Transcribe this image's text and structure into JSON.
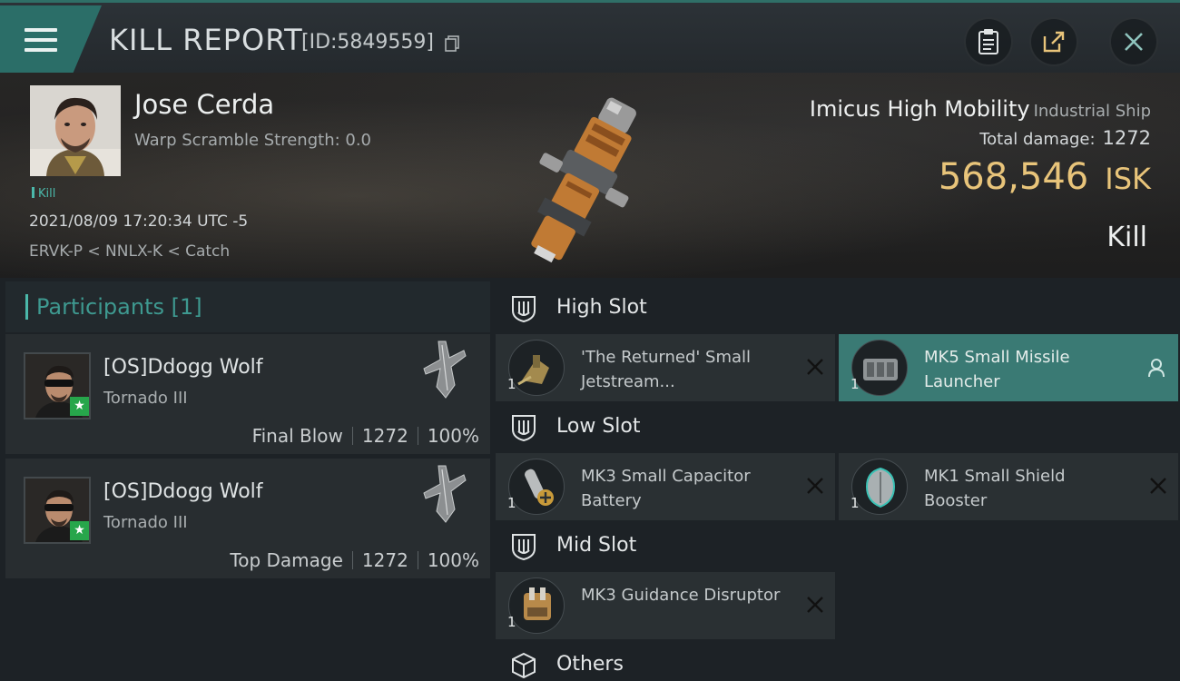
{
  "header": {
    "title": "KILL REPORT",
    "report_id": "[ID:5849559]",
    "icons": [
      "menu-icon",
      "copy-icon",
      "clipboard-icon",
      "share-icon",
      "close-icon"
    ]
  },
  "victim": {
    "name": "Jose Cerda",
    "warp_scramble": "Warp Scramble Strength: 0.0",
    "tag": "Kill",
    "datetime": "2021/08/09 17:20:34 UTC -5",
    "route": "ERVK-P < NNLX-K < Catch",
    "ship_name": "Imicus High Mobility",
    "ship_class": "Industrial Ship",
    "total_damage_label": "Total damage:",
    "total_damage": "1272",
    "isk_value": "568,546",
    "isk_unit": "ISK",
    "result": "Kill"
  },
  "participants": {
    "header": "Participants [1]",
    "items": [
      {
        "name": "[OS]Ddogg Wolf",
        "ship": "Tornado III",
        "role": "Final Blow",
        "damage": "1272",
        "percent": "100%"
      },
      {
        "name": "[OS]Ddogg Wolf",
        "ship": "Tornado III",
        "role": "Top Damage",
        "damage": "1272",
        "percent": "100%"
      }
    ]
  },
  "slots": {
    "high": {
      "label": "High Slot",
      "items": [
        {
          "name": "'The Returned' Small Jetstream...",
          "qty": "1"
        },
        {
          "name": "MK5 Small Missile Launcher",
          "qty": "1"
        }
      ]
    },
    "low": {
      "label": "Low Slot",
      "items": [
        {
          "name": "MK3 Small Capacitor Battery",
          "qty": "1"
        },
        {
          "name": "MK1 Small Shield Booster",
          "qty": "1"
        }
      ]
    },
    "mid": {
      "label": "Mid Slot",
      "items": [
        {
          "name": "MK3 Guidance Disruptor",
          "qty": "1"
        }
      ]
    },
    "others": {
      "label": "Others"
    }
  },
  "colors": {
    "accent": "#4bb8aa",
    "isk": "#e8c47a",
    "active_item": "#3a7a74"
  }
}
